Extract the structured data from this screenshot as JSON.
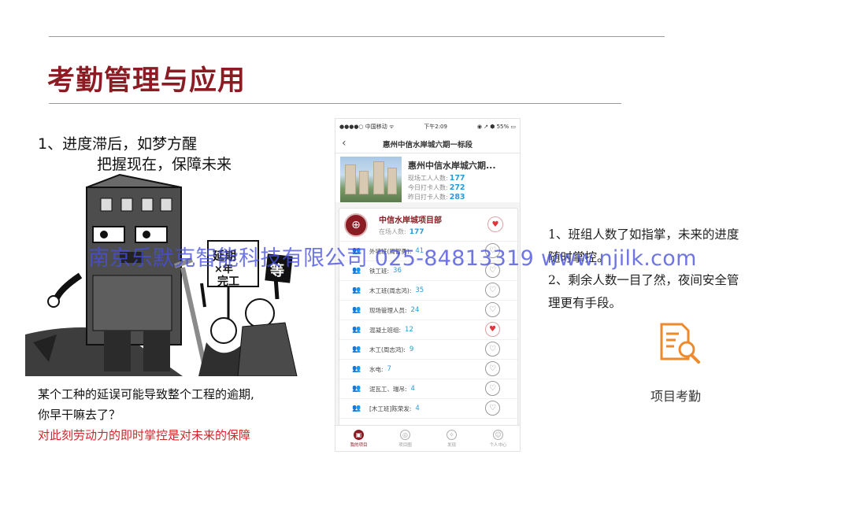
{
  "slide": {
    "title": "考勤管理与应用"
  },
  "left": {
    "heading": "1、进度滞后，如梦方醒",
    "subheading": "把握现在，保障未来",
    "cartoon_sign_1": "延期",
    "cartoon_sign_2": "×年",
    "cartoon_sign_3": "完工",
    "cartoon_sign_4": "等",
    "para_line1": "某个工种的延误可能导致整个工程的逾期,",
    "para_line2": "你早干嘛去了？",
    "para_line3": "对此刻劳动力的即时掌控是对未来的保障"
  },
  "phone": {
    "status": {
      "carrier": "●●●●○ 中国移动 ᯤ",
      "time": "下午2:09",
      "right": "◉ ↗ ⬢ 55% ▭"
    },
    "nav": {
      "back": "‹",
      "title": "惠州中信水岸城六期一标段"
    },
    "site": {
      "name": "惠州中信水岸城六期...",
      "stats": [
        {
          "label": "现场工人人数:",
          "value": "177"
        },
        {
          "label": "今日打卡人数:",
          "value": "272"
        },
        {
          "label": "昨日打卡人数:",
          "value": "283"
        }
      ]
    },
    "project": {
      "name": "中信水岸城项目部",
      "count_label": "在场人数:",
      "count_value": "177"
    },
    "teams": [
      {
        "name": "外墙班(周智勇):",
        "value": "41",
        "fav": false
      },
      {
        "name": "铁工班:",
        "value": "36",
        "fav": false
      },
      {
        "name": "木工班(周志鸿):",
        "value": "35",
        "fav": false
      },
      {
        "name": "现场管理人员:",
        "value": "24",
        "fav": false
      },
      {
        "name": "混凝土班组:",
        "value": "12",
        "fav": true
      },
      {
        "name": "木工(周志鸿):",
        "value": "9",
        "fav": false
      },
      {
        "name": "水电:",
        "value": "7",
        "fav": false
      },
      {
        "name": "泥瓦工、瑞吊:",
        "value": "4",
        "fav": false
      },
      {
        "name": "[木工班]陈荣发:",
        "value": "4",
        "fav": false
      }
    ],
    "tabs": [
      "我的项目",
      "项目圈",
      "发现",
      "个人中心"
    ]
  },
  "right": {
    "line1": "1、班组人数了如指掌，未来的进度",
    "line2": "随时掌控。",
    "line3": "2、剩余人数一目了然，夜间安全管",
    "line4": "理更有手段。",
    "feature_label": "项目考勤"
  },
  "watermark": "南京乐默克智能科技有限公司 025-84813319 www.njilk.com",
  "icons": {
    "team": "people-icon",
    "heart": "heart-icon",
    "feature": "document-search-icon"
  },
  "colors": {
    "title": "#8b1c24",
    "accent_blue": "#2a9ad8",
    "highlight_red": "#d0262b",
    "icon_orange": "#ee8a2c"
  }
}
